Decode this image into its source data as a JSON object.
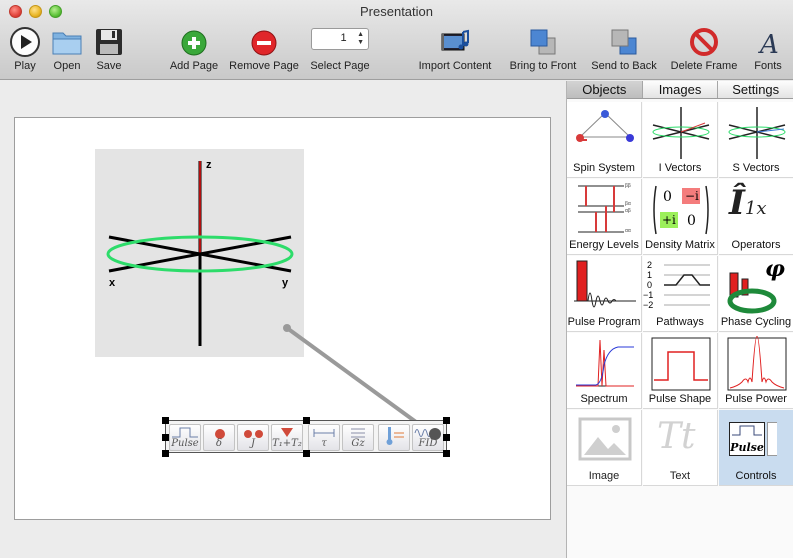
{
  "window": {
    "title": "Presentation"
  },
  "toolbar": {
    "play": "Play",
    "open": "Open",
    "save": "Save",
    "add_page": "Add Page",
    "remove_page": "Remove Page",
    "select_page": "Select Page",
    "page_value": "1",
    "import_content": "Import Content",
    "bring_to_front": "Bring to Front",
    "send_to_back": "Send to Back",
    "delete_frame": "Delete Frame",
    "fonts": "Fonts"
  },
  "slide": {
    "axis_z": "z",
    "axis_x": "x",
    "axis_y": "y",
    "controls": [
      "Pulse",
      "δ",
      "J",
      "T₁+T₂",
      "τ",
      "Gz",
      "",
      "FID"
    ]
  },
  "panel": {
    "tabs": [
      "Objects",
      "Images",
      "Settings"
    ],
    "active_tab": "Objects",
    "items": [
      {
        "label": "Spin System"
      },
      {
        "label": "I Vectors"
      },
      {
        "label": "S Vectors"
      },
      {
        "label": "Energy Levels"
      },
      {
        "label": "Density Matrix"
      },
      {
        "label": "Operators"
      },
      {
        "label": "Pulse Program"
      },
      {
        "label": "Pathways"
      },
      {
        "label": "Phase Cycling"
      },
      {
        "label": "Spectrum"
      },
      {
        "label": "Pulse Shape"
      },
      {
        "label": "Pulse Power"
      },
      {
        "label": "Image"
      },
      {
        "label": "Text"
      },
      {
        "label": "Controls"
      }
    ],
    "energy_labels": [
      "ββ",
      "βα",
      "αβ",
      "αα"
    ],
    "matrix": [
      "0",
      "−i",
      "+i",
      "0"
    ],
    "operator": "Î",
    "operator_sub": "1x",
    "pathway_ticks": [
      "2",
      "1",
      "0",
      "−1",
      "−2"
    ],
    "phase_symbol": "φ",
    "text_glyph": "Tt",
    "controls_thumb": "Pulse"
  },
  "colors": {
    "accent_selected": "#c9dcef",
    "circle": "#2ddc6a",
    "z_axis": "#b01010"
  }
}
